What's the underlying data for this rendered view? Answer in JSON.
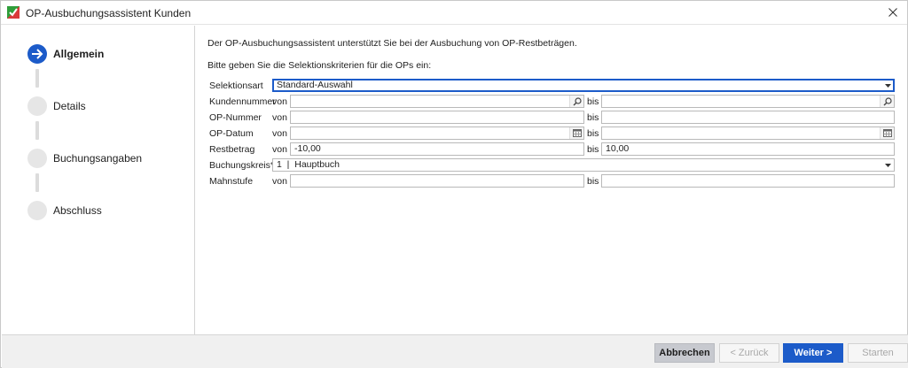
{
  "window": {
    "title": "OP-Ausbuchungsassistent Kunden"
  },
  "steps": [
    {
      "label": "Allgemein",
      "state": "active"
    },
    {
      "label": "Details",
      "state": "pending"
    },
    {
      "label": "Buchungsangaben",
      "state": "pending"
    },
    {
      "label": "Abschluss",
      "state": "pending"
    }
  ],
  "intro": {
    "line1": "Der OP-Ausbuchungsassistent unterstützt Sie bei der Ausbuchung von OP-Restbeträgen.",
    "line2": "Bitte geben Sie die Selektionskriterien für die OPs ein:"
  },
  "form": {
    "von": "von",
    "bis": "bis",
    "selektionsart": {
      "label": "Selektionsart",
      "value": "Standard-Auswahl"
    },
    "kundennummer": {
      "label": "Kundennummer",
      "from": "",
      "to": ""
    },
    "opnummer": {
      "label": "OP-Nummer",
      "from": "",
      "to": ""
    },
    "opdatum": {
      "label": "OP-Datum",
      "from": "",
      "to": ""
    },
    "restbetrag": {
      "label": "Restbetrag",
      "from": "-10,00",
      "to": "10,00"
    },
    "buchungskreis": {
      "label": "Buchungskreis*",
      "value": "1  |  Hauptbuch"
    },
    "mahnstufe": {
      "label": "Mahnstufe",
      "from": "",
      "to": ""
    }
  },
  "footer": {
    "cancel": "Abbrechen",
    "back": "< Zurück",
    "next": "Weiter >",
    "start": "Starten"
  },
  "colors": {
    "accent": "#1c5bc9"
  }
}
